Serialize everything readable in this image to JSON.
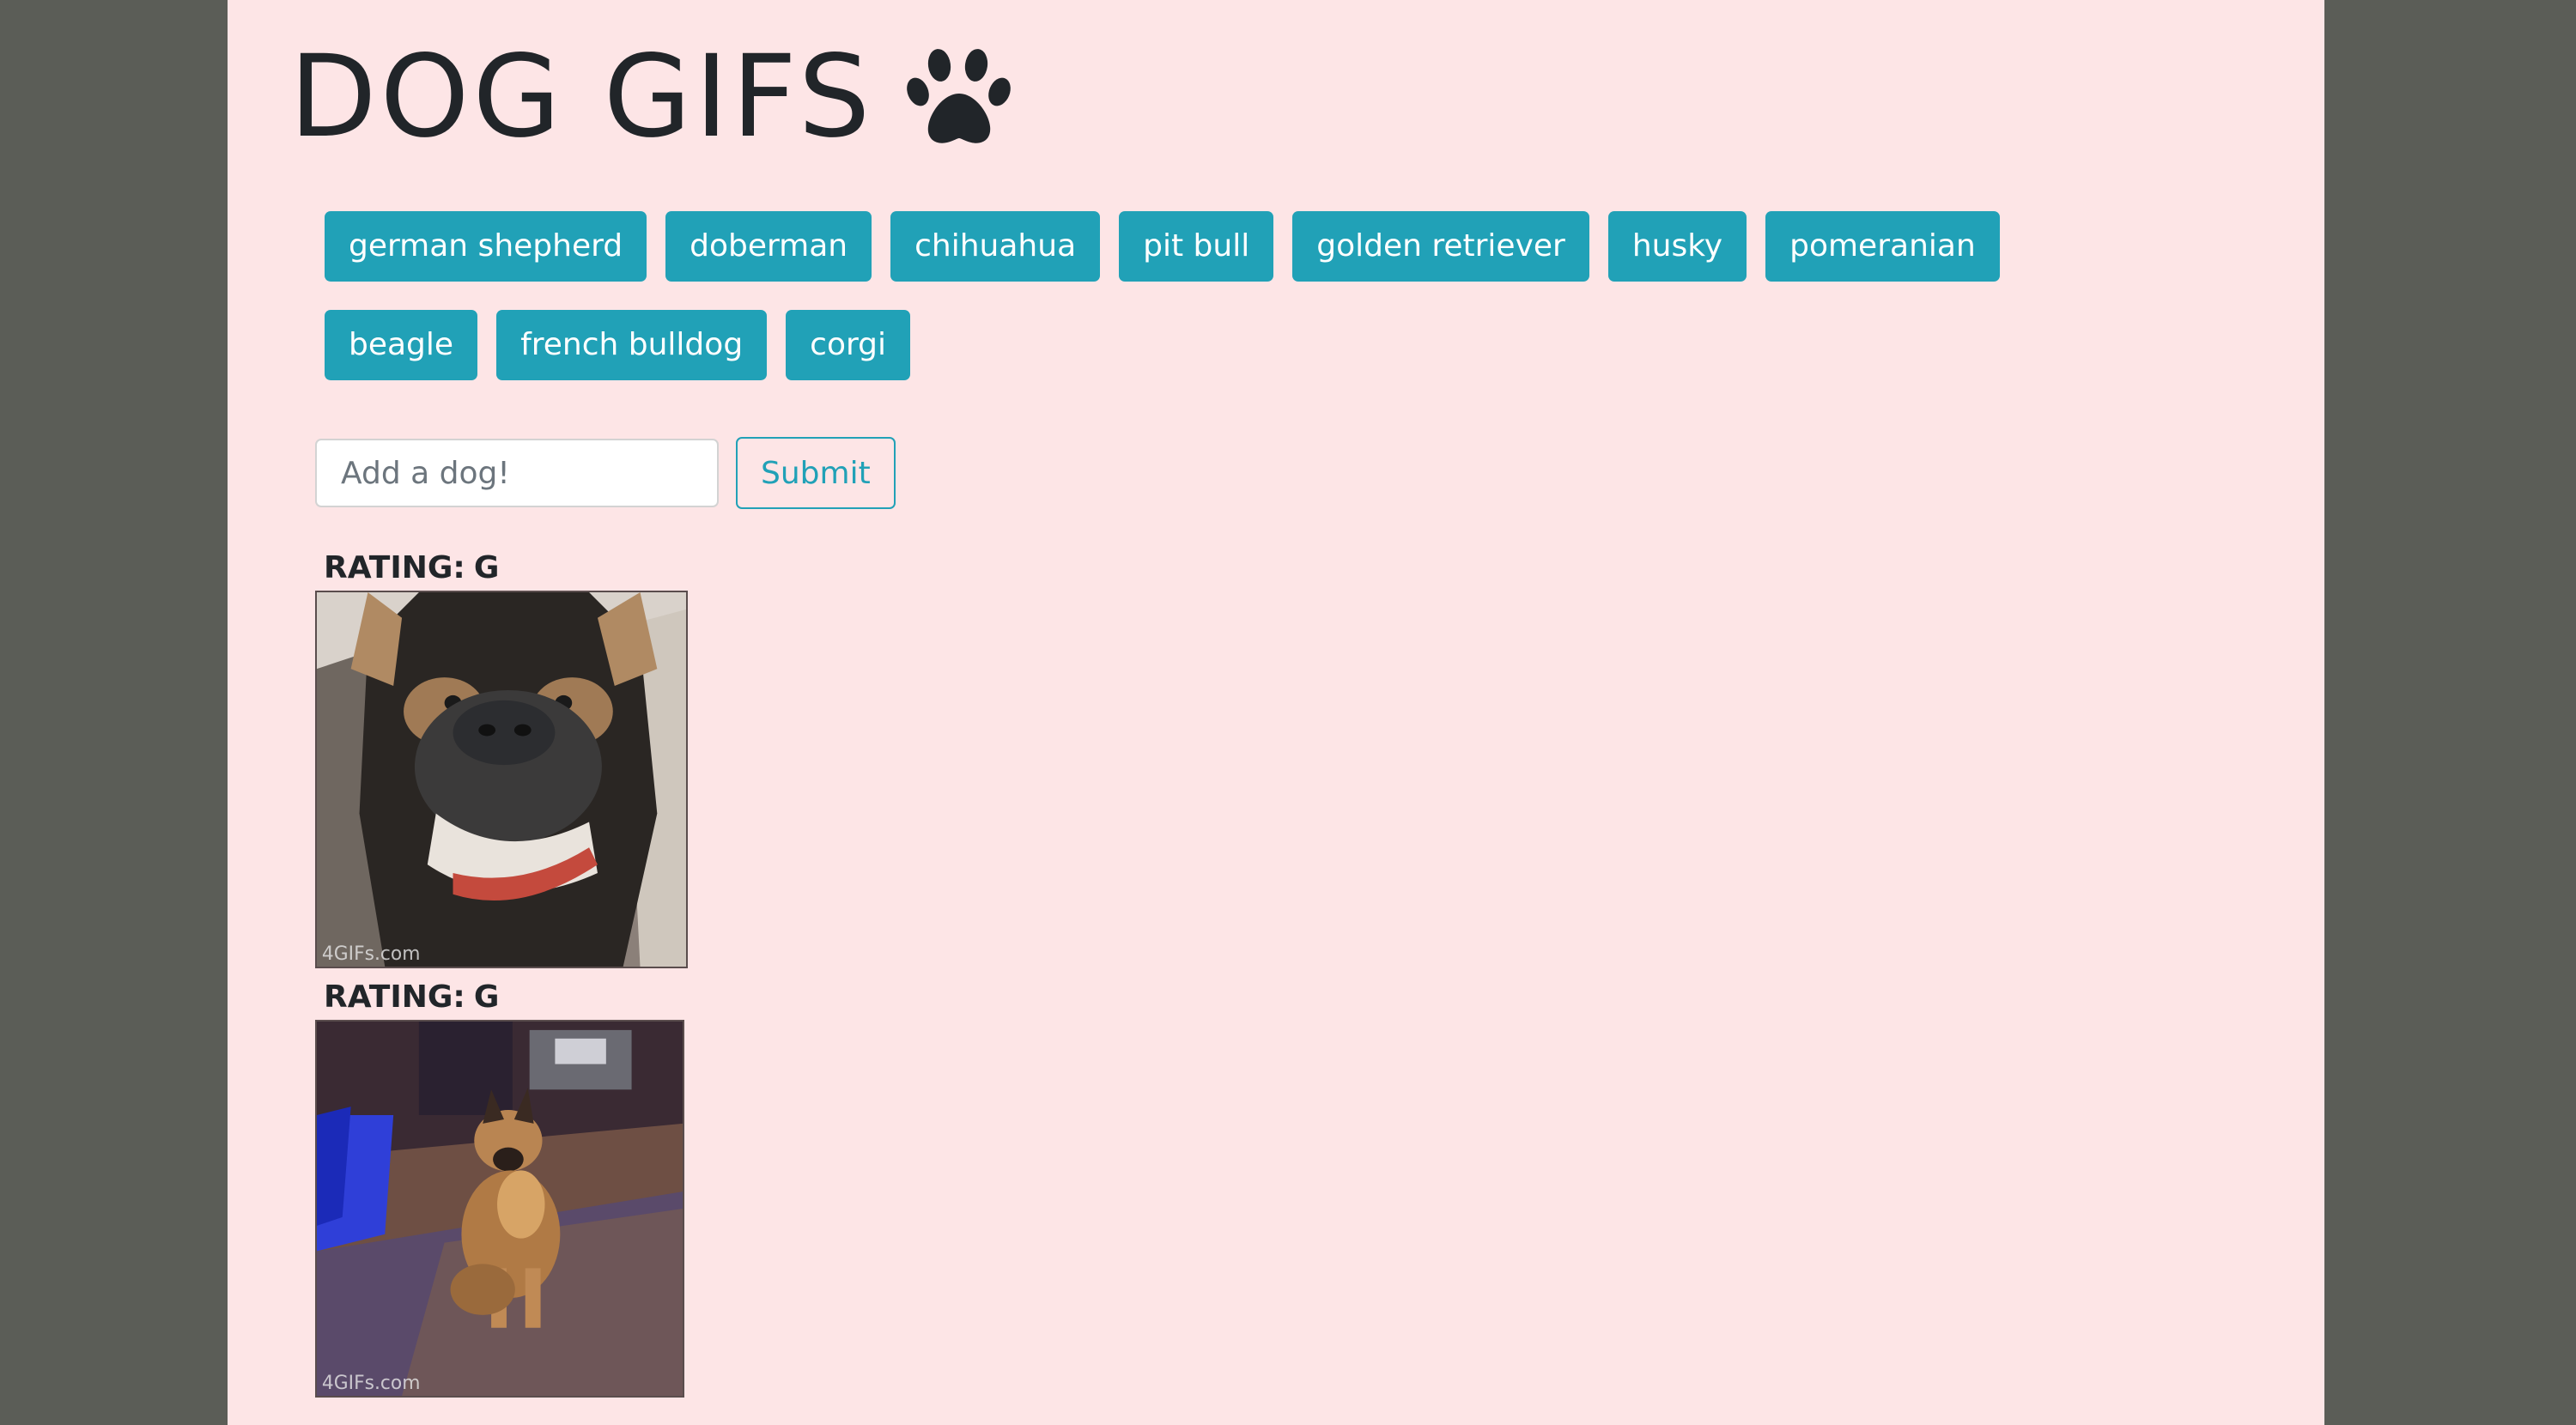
{
  "header": {
    "title": "DOG GIFS",
    "icon": "paw-icon"
  },
  "dog_buttons": [
    "german shepherd",
    "doberman",
    "chihuahua",
    "pit bull",
    "golden retriever",
    "husky",
    "pomeranian",
    "beagle",
    "french bulldog",
    "corgi"
  ],
  "form": {
    "placeholder": "Add a dog!",
    "value": "",
    "submit_label": "Submit"
  },
  "gifs": [
    {
      "rating_label": "RATING:",
      "rating": "G",
      "watermark": "4GIFs.com"
    },
    {
      "rating_label": "RATING:",
      "rating": "G",
      "watermark": "4GIFs.com"
    }
  ],
  "colors": {
    "page_background": "#fde5e6",
    "side_background": "#5b5d57",
    "button_teal": "#21a1b7",
    "text_dark": "#212529"
  }
}
